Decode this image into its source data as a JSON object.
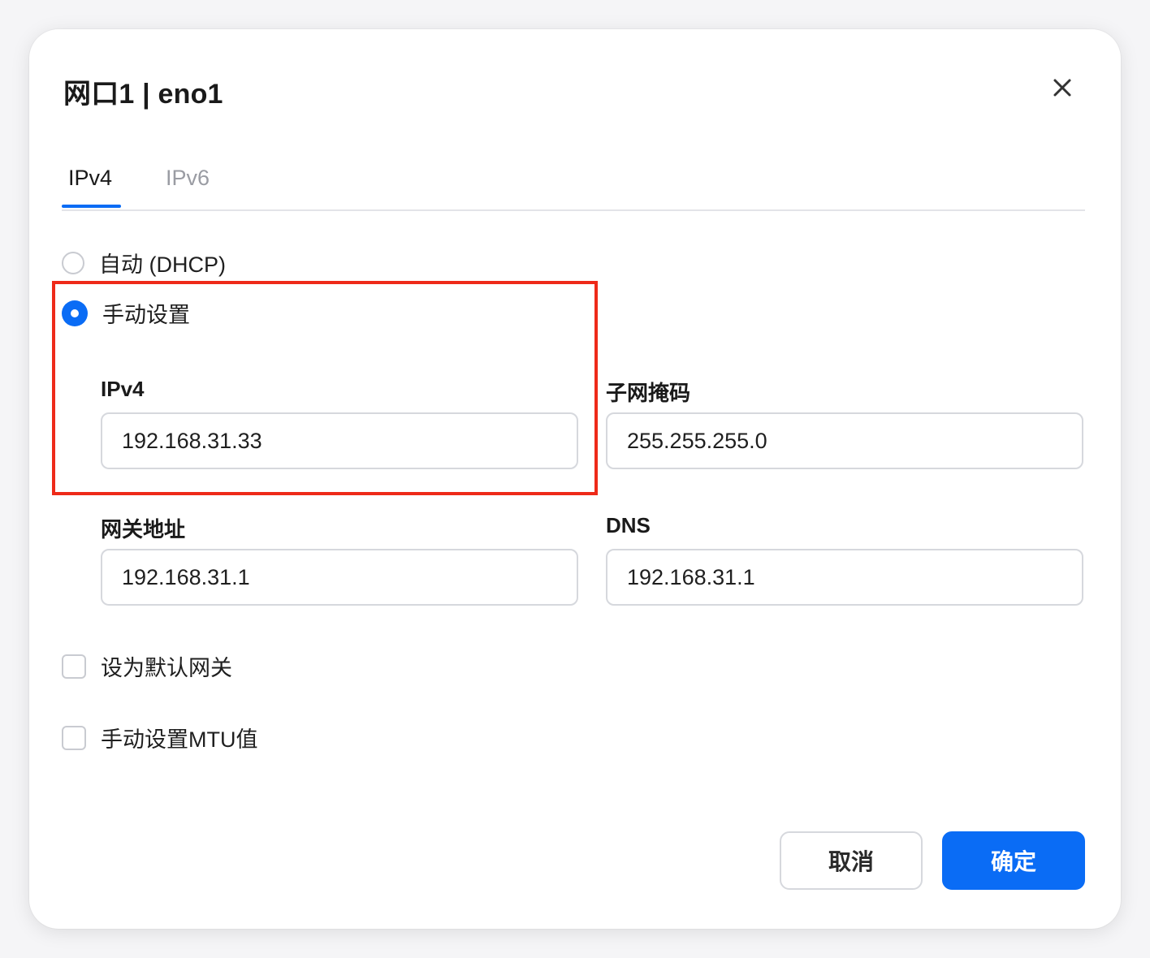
{
  "dialog": {
    "title": "网口1 | eno1",
    "close_icon": "close-icon"
  },
  "tabs": [
    {
      "label": "IPv4",
      "active": true
    },
    {
      "label": "IPv6",
      "active": false
    }
  ],
  "mode_options": [
    {
      "label": "自动 (DHCP)",
      "checked": false
    },
    {
      "label": "手动设置",
      "checked": true
    }
  ],
  "fields": {
    "ipv4": {
      "label": "IPv4",
      "value": "192.168.31.33"
    },
    "subnet_mask": {
      "label": "子网掩码",
      "value": "255.255.255.0"
    },
    "gateway": {
      "label": "网关地址",
      "value": "192.168.31.1"
    },
    "dns": {
      "label": "DNS",
      "value": "192.168.31.1"
    }
  },
  "checkboxes": [
    {
      "label": "设为默认网关",
      "checked": false
    },
    {
      "label": "手动设置MTU值",
      "checked": false
    }
  ],
  "buttons": {
    "cancel_label": "取消",
    "confirm_label": "确定"
  },
  "colors": {
    "accent": "#0a6cf5",
    "highlight": "#ee2a19"
  }
}
